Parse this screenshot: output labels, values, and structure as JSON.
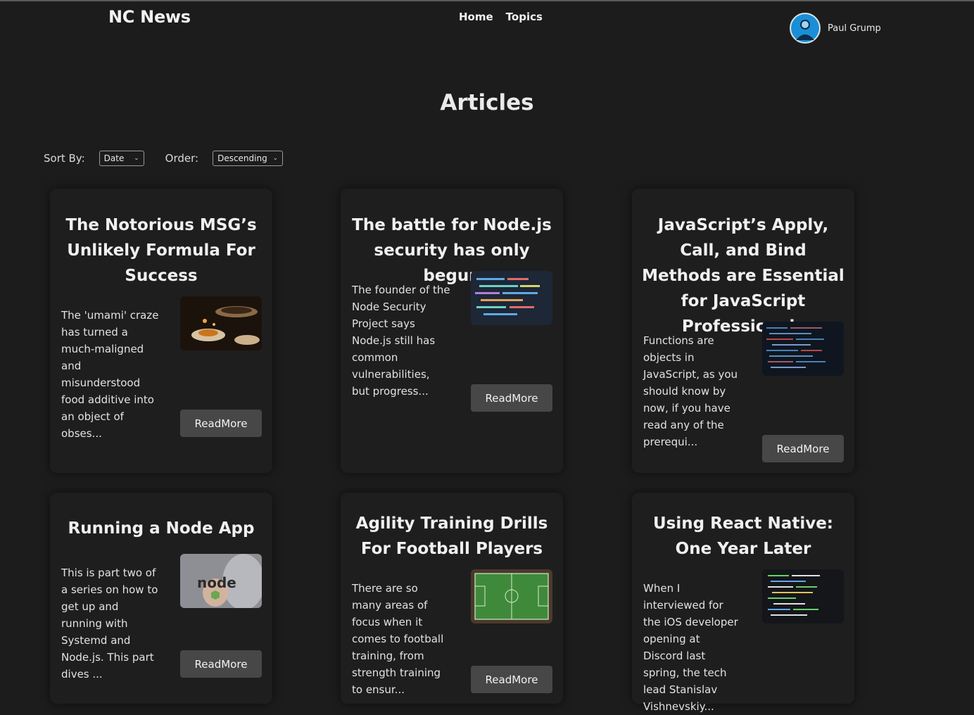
{
  "header": {
    "logo": "NC News",
    "nav": [
      "Home",
      "Topics"
    ],
    "user": {
      "name": "Paul Grump",
      "avatar_icon": "user-avatar-icon"
    }
  },
  "page": {
    "title": "Articles"
  },
  "controls": {
    "sort_label": "Sort By:",
    "sort_value": "Date",
    "order_label": "Order:",
    "order_value": "Descending"
  },
  "articles": [
    {
      "title": "The Notorious MSG’s Unlikely Formula For Success",
      "description": "The 'umami' craze has turned a much-maligned and misunderstood food additive into an object of obses...",
      "button": "ReadMore",
      "image": "food-cooking-image"
    },
    {
      "title": "The battle for Node.js security has only begun",
      "description": "The founder of the Node Security Project says Node.js still has common vulnerabilities, but progress...",
      "button": "ReadMore",
      "image": "code-screen-image"
    },
    {
      "title": "JavaScript’s Apply, Call, and Bind Methods are Essential for JavaScript Professionals",
      "description": "Functions are objects in JavaScript, as you should know by now, if you have read any of the prerequi...",
      "button": "ReadMore",
      "image": "code-screen-image"
    },
    {
      "title": "Running a Node App",
      "description": "This is part two of a series on how to get up and running with Systemd and Node.js. This part dives ...",
      "button": "ReadMore",
      "image": "node-sticker-image"
    },
    {
      "title": "Agility Training Drills For Football Players",
      "description": "There are so many areas of focus when it comes to football training, from strength training to ensur...",
      "button": "ReadMore",
      "image": "football-pitch-image"
    },
    {
      "title": "Using React Native: One Year Later",
      "description": "When I interviewed for the iOS developer opening at Discord last spring, the tech lead Stanislav Vishnevskiy...",
      "button": "ReadMore",
      "image": "code-editor-image"
    }
  ]
}
